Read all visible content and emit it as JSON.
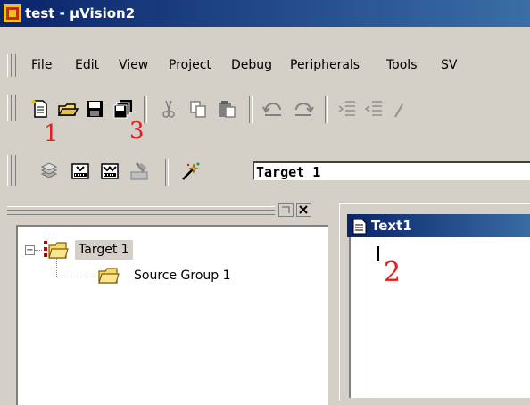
{
  "window": {
    "title": "test - µVision2"
  },
  "menu": {
    "items": [
      "File",
      "Edit",
      "View",
      "Project",
      "Debug",
      "Peripherals",
      "Tools",
      "SV"
    ]
  },
  "annotations": {
    "one": "1",
    "two": "2",
    "three": "3"
  },
  "build_toolbar": {
    "target_value": "Target 1"
  },
  "project_tree": {
    "root_label": "Target 1",
    "child_label": "Source Group 1",
    "expander": "−"
  },
  "editor": {
    "title": "Text1"
  },
  "icons": {
    "new_file": "new-file-icon",
    "open": "open-folder-icon",
    "save": "save-icon",
    "save_all": "save-all-icon",
    "cut": "cut-icon",
    "copy": "copy-icon",
    "paste": "paste-icon",
    "undo": "undo-icon",
    "redo": "redo-icon",
    "indent": "indent-icon",
    "outdent": "outdent-icon",
    "translate": "translate-icon",
    "build": "build-icon",
    "rebuild": "rebuild-icon",
    "stop": "stop-build-icon",
    "target_options": "target-options-icon"
  },
  "colors": {
    "titlebar": "#0a246a",
    "annotation": "#e02020",
    "folder": "#f5d96b"
  }
}
